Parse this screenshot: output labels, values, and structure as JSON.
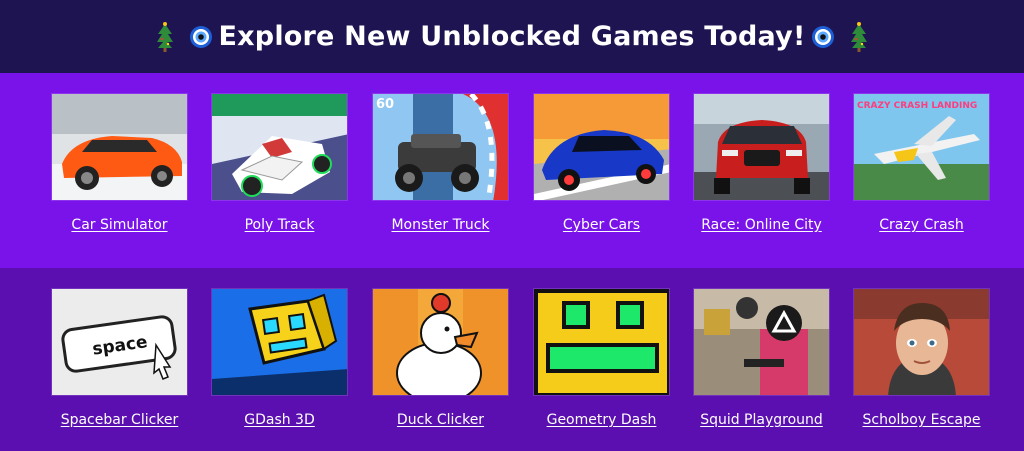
{
  "header": {
    "title": "Explore New Unblocked Games Today!",
    "left_icons": [
      "christmas-tree-icon",
      "evil-eye-icon"
    ],
    "right_icons": [
      "evil-eye-icon",
      "christmas-tree-icon"
    ]
  },
  "colors": {
    "header_bg": "#1e1452",
    "row1_bg": "#7a12ea",
    "row2_bg": "#5b0fb0",
    "text": "#ffffff"
  },
  "rows": [
    {
      "games": [
        {
          "label": "Car Simulator",
          "thumb": "car-simulator-thumbnail"
        },
        {
          "label": "Poly Track",
          "thumb": "poly-track-thumbnail"
        },
        {
          "label": "Monster Truck",
          "thumb": "monster-truck-thumbnail"
        },
        {
          "label": "Cyber Cars",
          "thumb": "cyber-cars-thumbnail"
        },
        {
          "label": "Race: Online City",
          "thumb": "race-online-city-thumbnail"
        },
        {
          "label": "Crazy Crash",
          "thumb": "crazy-crash-thumbnail"
        }
      ]
    },
    {
      "games": [
        {
          "label": "Spacebar Clicker",
          "thumb": "spacebar-clicker-thumbnail"
        },
        {
          "label": "GDash 3D",
          "thumb": "gdash-3d-thumbnail"
        },
        {
          "label": "Duck Clicker",
          "thumb": "duck-clicker-thumbnail"
        },
        {
          "label": "Geometry Dash",
          "thumb": "geometry-dash-thumbnail"
        },
        {
          "label": "Squid Playground",
          "thumb": "squid-playground-thumbnail"
        },
        {
          "label": "Scholboy Escape",
          "thumb": "scholboy-escape-thumbnail"
        }
      ]
    }
  ],
  "thumb_texts": {
    "monster_truck_score": "60",
    "spacebar_key": "space",
    "crazy_crash_logo": "CRAZY CRASH LANDING"
  }
}
